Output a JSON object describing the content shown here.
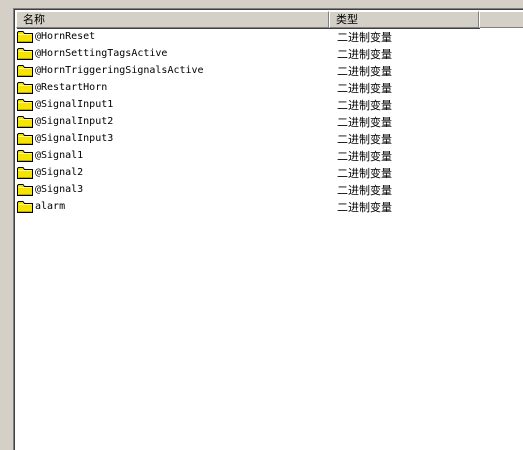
{
  "columns": {
    "name": "名称",
    "type": "类型"
  },
  "icon": "folder-icon",
  "rows": [
    {
      "name": "@HornReset",
      "type": "二进制变量"
    },
    {
      "name": "@HornSettingTagsActive",
      "type": "二进制变量"
    },
    {
      "name": "@HornTriggeringSignalsActive",
      "type": "二进制变量"
    },
    {
      "name": "@RestartHorn",
      "type": "二进制变量"
    },
    {
      "name": "@SignalInput1",
      "type": "二进制变量"
    },
    {
      "name": "@SignalInput2",
      "type": "二进制变量"
    },
    {
      "name": "@SignalInput3",
      "type": "二进制变量"
    },
    {
      "name": "@Signal1",
      "type": "二进制变量"
    },
    {
      "name": "@Signal2",
      "type": "二进制变量"
    },
    {
      "name": "@Signal3",
      "type": "二进制变量"
    },
    {
      "name": "alarm",
      "type": "二进制变量"
    }
  ]
}
